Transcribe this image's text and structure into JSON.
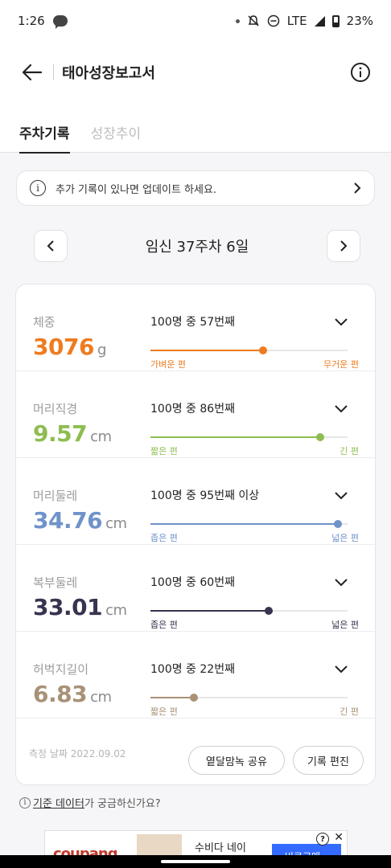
{
  "status_bar": {
    "time": "1:26",
    "network": "LTE",
    "battery": "23%",
    "icons": [
      "talk-icon",
      "dot-icon",
      "mute-icon",
      "dnd-icon",
      "signal-icon",
      "battery-icon"
    ]
  },
  "app_bar": {
    "title": "태아성장보고서",
    "back_icon": "arrow-left-icon",
    "info_icon": "info-circle-icon"
  },
  "tabs": [
    {
      "label": "주차기록",
      "active": true
    },
    {
      "label": "성장추이",
      "active": false
    }
  ],
  "notice": {
    "text": "추가 기록이 있나면 업데이트 하세요.",
    "icon": "info-icon",
    "i_glyph": "i"
  },
  "week": {
    "label": "임신 37주차 6일"
  },
  "colors": {
    "weight": "#ef7b1f",
    "head_diameter": "#8dbd50",
    "head_circumference": "#6f93c9",
    "abdomen": "#36344f",
    "femur": "#a99176"
  },
  "metrics": [
    {
      "key": "weight",
      "label": "체중",
      "value": "3076",
      "unit": "g",
      "rank": "100명 중 57번째",
      "percentile": 0.57,
      "min_label": "가벼운 편",
      "max_label": "무거운 편",
      "color": "#ef7b1f"
    },
    {
      "key": "head_diameter",
      "label": "머리직경",
      "value": "9.57",
      "unit": "cm",
      "rank": "100명 중 86번째",
      "percentile": 0.86,
      "min_label": "짧은 편",
      "max_label": "긴 편",
      "color": "#8dbd50"
    },
    {
      "key": "head_circumference",
      "label": "머리둘레",
      "value": "34.76",
      "unit": "cm",
      "rank": "100명 중 95번째 이상",
      "percentile": 0.95,
      "min_label": "좁은 편",
      "max_label": "넓은 편",
      "color": "#6f93c9"
    },
    {
      "key": "abdomen",
      "label": "복부둘레",
      "value": "33.01",
      "unit": "cm",
      "rank": "100명 중 60번째",
      "percentile": 0.6,
      "min_label": "좁은 편",
      "max_label": "넓은 편",
      "color": "#36344f"
    },
    {
      "key": "femur",
      "label": "허벅지길이",
      "value": "6.83",
      "unit": "cm",
      "rank": "100명 중 22번째",
      "percentile": 0.22,
      "min_label": "짧은 편",
      "max_label": "긴 편",
      "color": "#a99176"
    }
  ],
  "footer": {
    "measure_date": "측정 날짜 2022.09.02",
    "share_button": "옅달맘녹 공유",
    "edit_button": "기록 편진"
  },
  "help": {
    "link_text": "기준 데이터",
    "suffix": "가 궁금하신가요?",
    "i_glyph": "i"
  },
  "ad": {
    "brand": "coupang",
    "text": "수비다 네이",
    "cta": "비로구매~",
    "q_glyph": "?",
    "x_glyph": "✕"
  }
}
